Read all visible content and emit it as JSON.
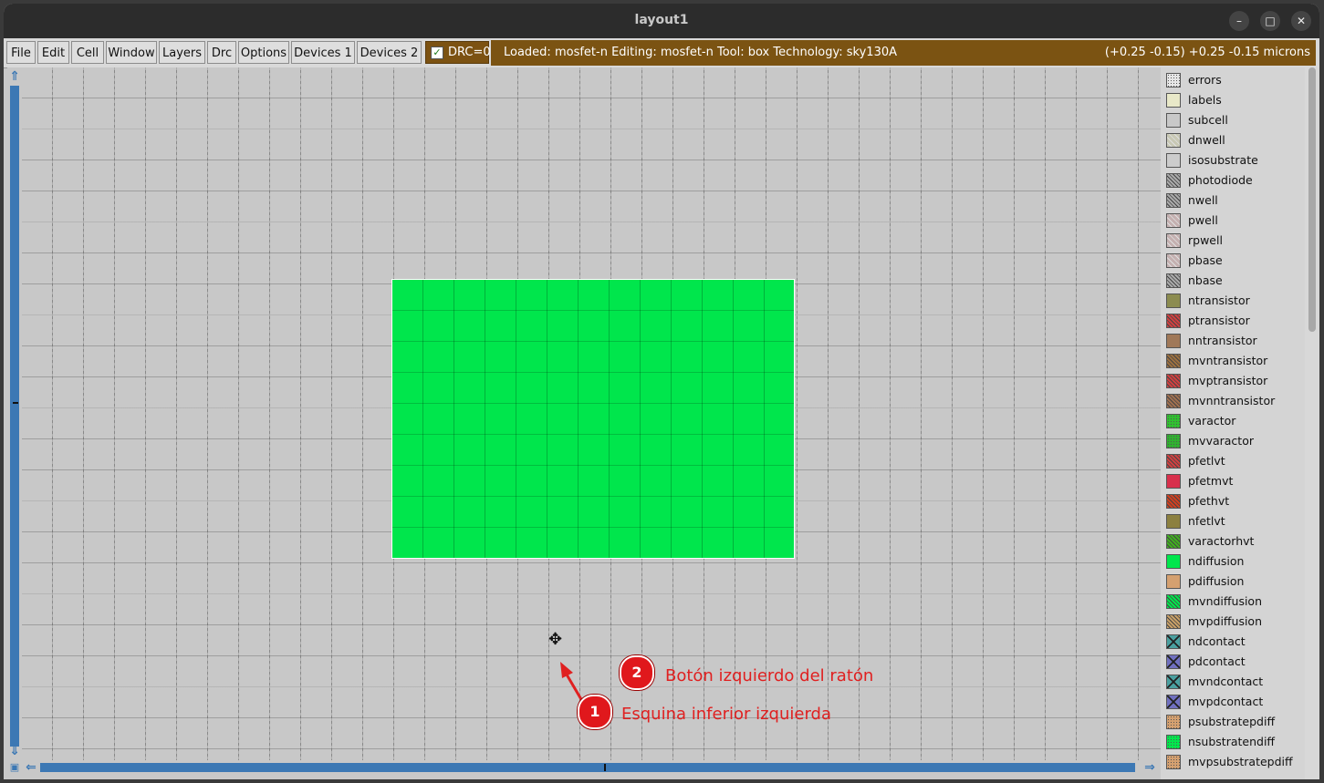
{
  "window": {
    "title": "layout1",
    "controls": [
      "–",
      "□",
      "✕"
    ]
  },
  "menu": [
    "File",
    "Edit",
    "Cell",
    "Window",
    "Layers",
    "Drc",
    "Options",
    "Devices 1",
    "Devices 2"
  ],
  "drc": {
    "label": "DRC=0",
    "checked": true
  },
  "status": {
    "left": "Loaded: mosfet-n Editing: mosfet-n Tool: box  Technology: sky130A",
    "right": "(+0.25 -0.15) +0.25 -0.15 microns"
  },
  "annotations": [
    {
      "number": "2",
      "text": "Botón izquierdo del ratón"
    },
    {
      "number": "1",
      "text": "Esquina inferior izquierda"
    }
  ],
  "layers": [
    {
      "name": "errors",
      "color": "#e6e6e6",
      "pattern": "dots"
    },
    {
      "name": "labels",
      "color": "#e8e8c8",
      "pattern": "solid"
    },
    {
      "name": "subcell",
      "color": "#c8c8c8",
      "pattern": "solid"
    },
    {
      "name": "dnwell",
      "color": "#c8c8b4",
      "pattern": "diag"
    },
    {
      "name": "isosubstrate",
      "color": "#cccccc",
      "pattern": "solid"
    },
    {
      "name": "photodiode",
      "color": "#aaaaaa",
      "pattern": "hatch"
    },
    {
      "name": "nwell",
      "color": "#aaaaaa",
      "pattern": "hatch"
    },
    {
      "name": "pwell",
      "color": "#c4b0b0",
      "pattern": "diag"
    },
    {
      "name": "rpwell",
      "color": "#c4b0b0",
      "pattern": "diag"
    },
    {
      "name": "pbase",
      "color": "#c4b0b0",
      "pattern": "diag"
    },
    {
      "name": "nbase",
      "color": "#aaaaaa",
      "pattern": "hatch"
    },
    {
      "name": "ntransistor",
      "color": "#8c8c50",
      "pattern": "solid"
    },
    {
      "name": "ptransistor",
      "color": "#d04040",
      "pattern": "hatch"
    },
    {
      "name": "nntransistor",
      "color": "#a07858",
      "pattern": "solid"
    },
    {
      "name": "mvntransistor",
      "color": "#9c7040",
      "pattern": "hatch"
    },
    {
      "name": "mvptransistor",
      "color": "#d04040",
      "pattern": "hatch"
    },
    {
      "name": "mvnntransistor",
      "color": "#a07050",
      "pattern": "hatch"
    },
    {
      "name": "varactor",
      "color": "#30c030",
      "pattern": "dots"
    },
    {
      "name": "mvvaractor",
      "color": "#30b030",
      "pattern": "dots"
    },
    {
      "name": "pfetlvt",
      "color": "#d04040",
      "pattern": "hatch"
    },
    {
      "name": "pfetmvt",
      "color": "#d8304c",
      "pattern": "solid"
    },
    {
      "name": "pfethvt",
      "color": "#d04020",
      "pattern": "hatch"
    },
    {
      "name": "nfetlvt",
      "color": "#8c8040",
      "pattern": "solid"
    },
    {
      "name": "varactorhvt",
      "color": "#40b020",
      "pattern": "hatch"
    },
    {
      "name": "ndiffusion",
      "color": "#00e64c",
      "pattern": "solid"
    },
    {
      "name": "pdiffusion",
      "color": "#d4a070",
      "pattern": "solid"
    },
    {
      "name": "mvndiffusion",
      "color": "#00e64c",
      "pattern": "hatch"
    },
    {
      "name": "mvpdiffusion",
      "color": "#c8a068",
      "pattern": "hatch"
    },
    {
      "name": "ndcontact",
      "color": "#4aa0a0",
      "pattern": "cross"
    },
    {
      "name": "pdcontact",
      "color": "#7070c0",
      "pattern": "cross"
    },
    {
      "name": "mvndcontact",
      "color": "#4aa0a0",
      "pattern": "cross"
    },
    {
      "name": "mvpdcontact",
      "color": "#7070c0",
      "pattern": "cross"
    },
    {
      "name": "psubstratepdiff",
      "color": "#d4a070",
      "pattern": "dots"
    },
    {
      "name": "nsubstratendiff",
      "color": "#00e64c",
      "pattern": "dots"
    },
    {
      "name": "mvpsubstratepdiff",
      "color": "#d4a070",
      "pattern": "dots"
    }
  ]
}
